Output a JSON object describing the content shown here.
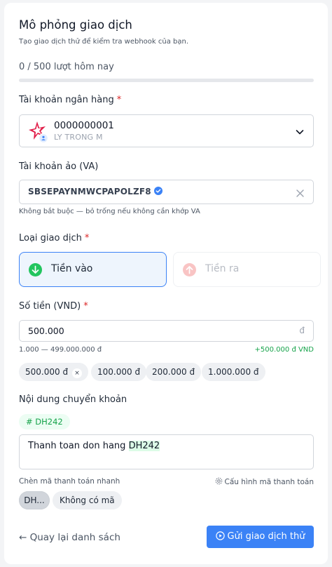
{
  "header": {
    "title": "Mô phỏng giao dịch",
    "subtitle": "Tạo giao dịch thử để kiểm tra webhook của bạn."
  },
  "quota": {
    "text": "0 / 500 lượt hôm nay",
    "used": 0,
    "limit": 500
  },
  "bank_account": {
    "label": "Tài khoản ngân hàng",
    "required_mark": "*",
    "number": "0000000001",
    "holder": "LY TRONG M",
    "logo_icon": "bank-star-logo",
    "logo_color": "#e11d48"
  },
  "virtual_account": {
    "label": "Tài khoản ảo (VA)",
    "value": "SBSEPAYNMWCPAPOLZF8",
    "hint": "Không bắt buộc — bỏ trống nếu không cần khớp VA"
  },
  "transaction_type": {
    "label": "Loại giao dịch",
    "required_mark": "*",
    "options": [
      {
        "label": "Tiền vào",
        "selected": true,
        "color": "#22c55e"
      },
      {
        "label": "Tiền ra",
        "selected": false,
        "color": "#ef4444"
      }
    ]
  },
  "amount": {
    "label": "Số tiền (VND)",
    "required_mark": "*",
    "value": "500.000",
    "unit": "đ",
    "range": "1.000 — 499.000.000 đ",
    "delta": "+500.000 đ VND",
    "presets": [
      {
        "label": "500.000 đ",
        "remove": "×"
      },
      {
        "label": "100.000 đ"
      },
      {
        "label": "200.000 đ"
      },
      {
        "label": "1.000.000 đ"
      }
    ]
  },
  "content": {
    "label": "Nội dung chuyển khoản",
    "code_tag": "# DH242",
    "text_prefix": "Thanh toan don hang ",
    "text_code": "DH242",
    "quick_label": "Chèn mã thanh toán nhanh",
    "config_link": "Cấu hình mã thanh toán",
    "quick_options": [
      "DH...",
      "Không có mã"
    ]
  },
  "footer": {
    "back": "← Quay lại danh sách",
    "submit": "Gửi giao dịch thử"
  },
  "colors": {
    "accent": "#3b82f6",
    "success": "#16a34a",
    "danger": "#dc2626"
  }
}
